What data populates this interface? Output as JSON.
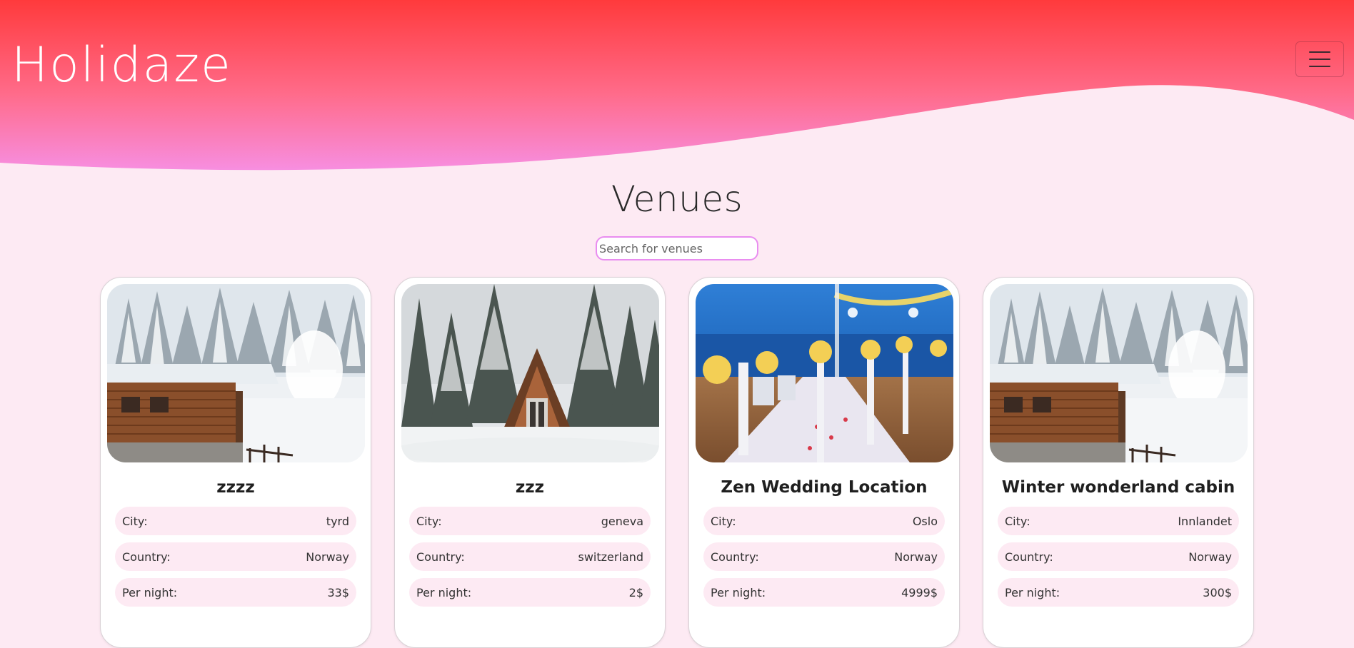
{
  "header": {
    "logo_text": "Holidaze",
    "gradient_top": "#ff3c3c",
    "gradient_bottom": "#f98ad8"
  },
  "main": {
    "title": "Venues",
    "search": {
      "placeholder": "Search for venues",
      "value": ""
    }
  },
  "labels": {
    "city": "City:",
    "country": "Country:",
    "per_night": "Per night:"
  },
  "venues": [
    {
      "name": "zzzz",
      "city": "tyrd",
      "country": "Norway",
      "price": "33$",
      "image": "snowy log cabin in forest"
    },
    {
      "name": "zzz",
      "city": "geneva",
      "country": "switzerland",
      "price": "2$",
      "image": "a-frame cabin in snowy pines"
    },
    {
      "name": "Zen Wedding Location",
      "city": "Oslo",
      "country": "Norway",
      "price": "4999$",
      "image": "beach wedding aisle at dusk"
    },
    {
      "name": "Winter wonderland cabin",
      "city": "Innlandet",
      "country": "Norway",
      "price": "300$",
      "image": "snowy log cabin in forest"
    }
  ]
}
